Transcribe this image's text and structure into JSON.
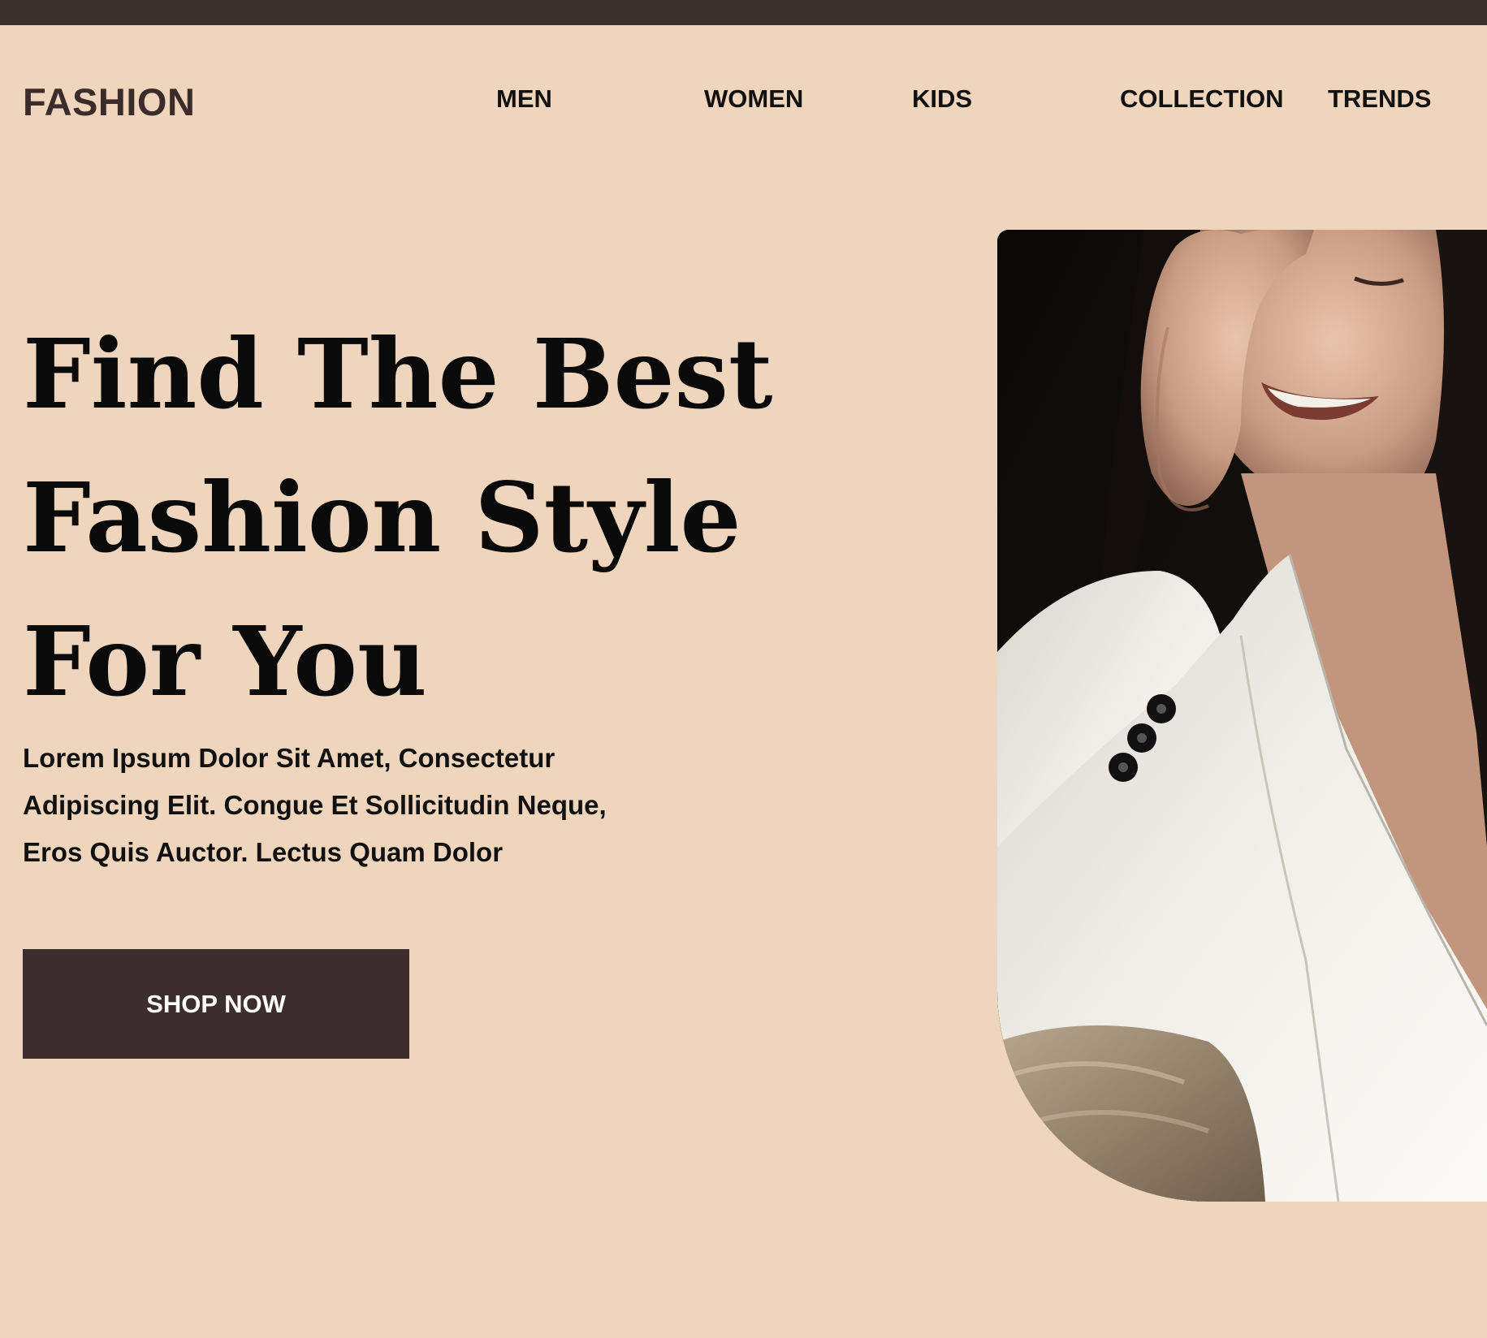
{
  "brand": {
    "logo": "FASHION",
    "top_bar_color": "#3b3230",
    "background_color": "#f0d5bd",
    "button_color": "#3e2d2f"
  },
  "nav": {
    "items": [
      "MEN",
      "WOMEN",
      "KIDS",
      "COLLECTION",
      "TRENDS"
    ]
  },
  "hero": {
    "title_lines": [
      "Find The Best",
      "Fashion Style",
      "For You"
    ],
    "description_lines": [
      "Lorem Ipsum Dolor Sit Amet, Consectetur",
      "Adipiscing Elit. Congue Et Sollicitudin Neque,",
      "Eros Quis Auctor. Lectus Quam Dolor"
    ],
    "cta_label": "SHOP NOW"
  }
}
